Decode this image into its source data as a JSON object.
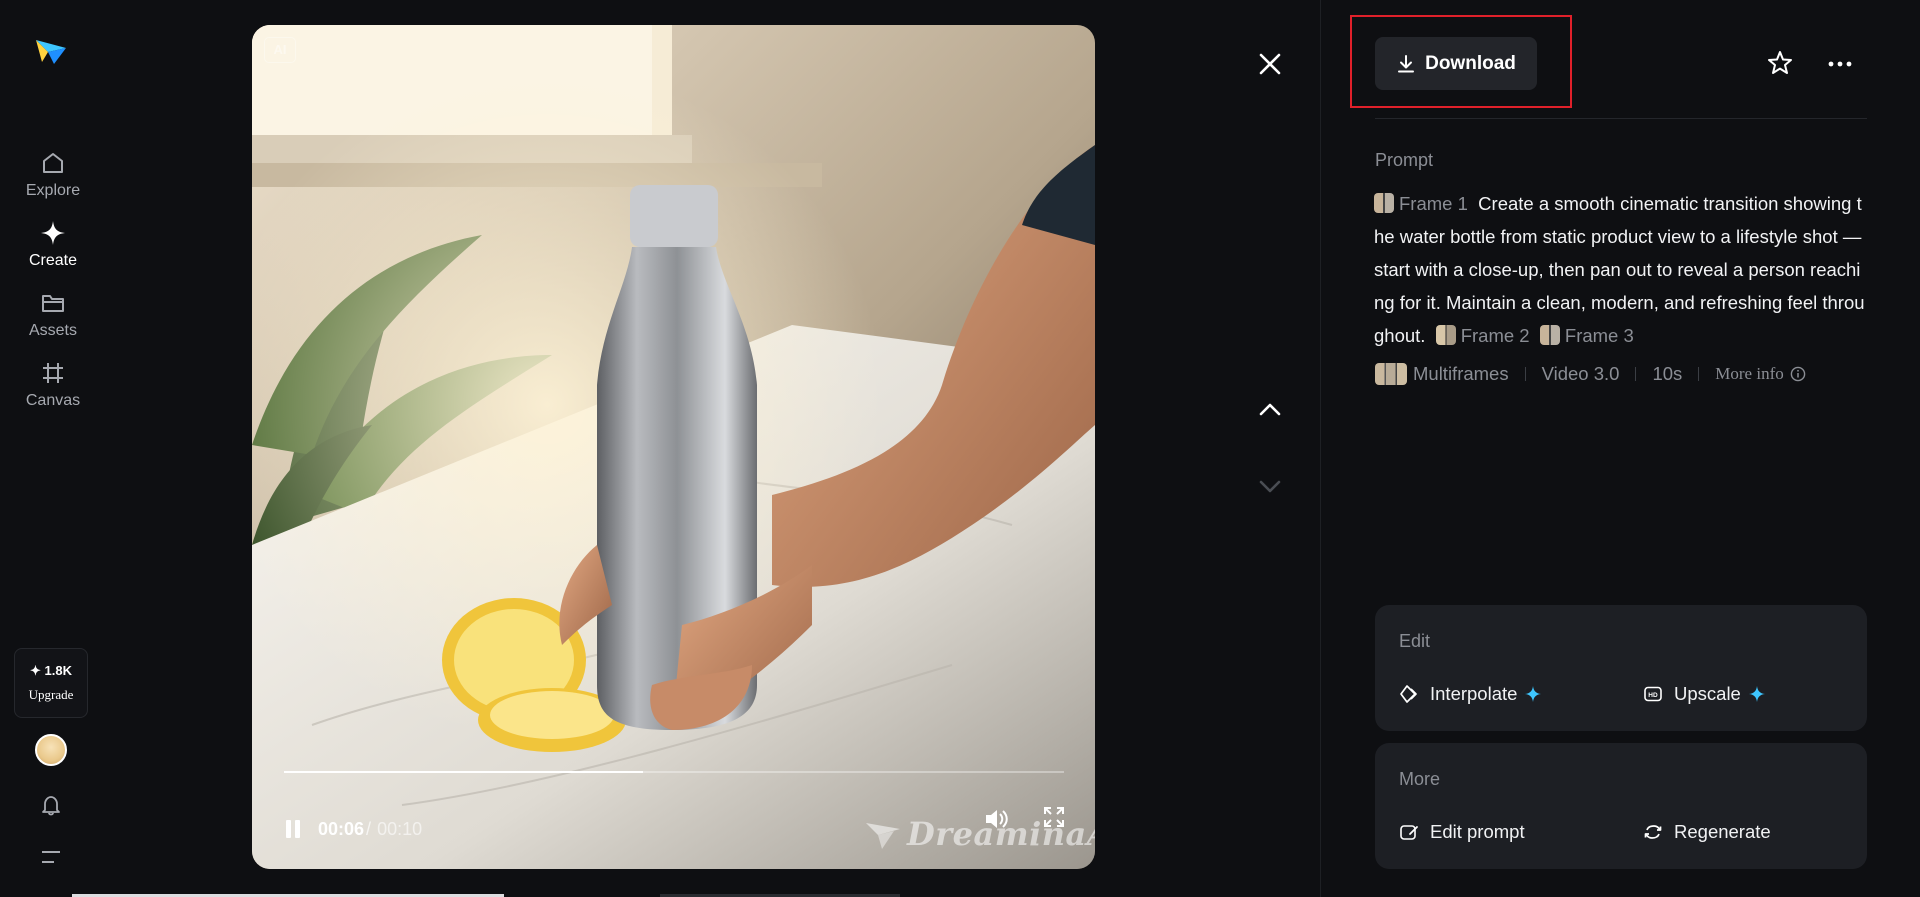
{
  "sidebar": {
    "items": [
      {
        "label": "Explore",
        "icon": "home-icon"
      },
      {
        "label": "Create",
        "icon": "sparkle-icon"
      },
      {
        "label": "Assets",
        "icon": "folder-icon"
      },
      {
        "label": "Canvas",
        "icon": "canvas-icon"
      }
    ],
    "credits": "✦ 1.8K",
    "upgrade_label": "Upgrade"
  },
  "player": {
    "ai_tag": "AI",
    "current_time": "00:06",
    "separator": "/",
    "total_time": "00:10",
    "progress": 0.46,
    "watermark": "DreaminaAI"
  },
  "actions": {
    "download_label": "Download"
  },
  "prompt": {
    "title": "Prompt",
    "frame1": "Frame 1",
    "text": "Create a smooth cinematic transition showing the water bottle from static product view to a lifestyle shot — start with a close-up, then pan out to reveal a person reaching for it. Maintain a clean, modern, and refreshing feel throughout.",
    "frame2": "Frame 2",
    "frame3": "Frame 3"
  },
  "meta": {
    "mode": "Multiframes",
    "model": "Video 3.0",
    "duration": "10s",
    "more_info": "More info"
  },
  "edit_card": {
    "title": "Edit",
    "interpolate": "Interpolate",
    "upscale": "Upscale"
  },
  "more_card": {
    "title": "More",
    "edit_prompt": "Edit prompt",
    "regenerate": "Regenerate"
  },
  "colors": {
    "accent_highlight": "#e0202a",
    "spark": "#3ec6ff",
    "background": "#0e0f12"
  }
}
